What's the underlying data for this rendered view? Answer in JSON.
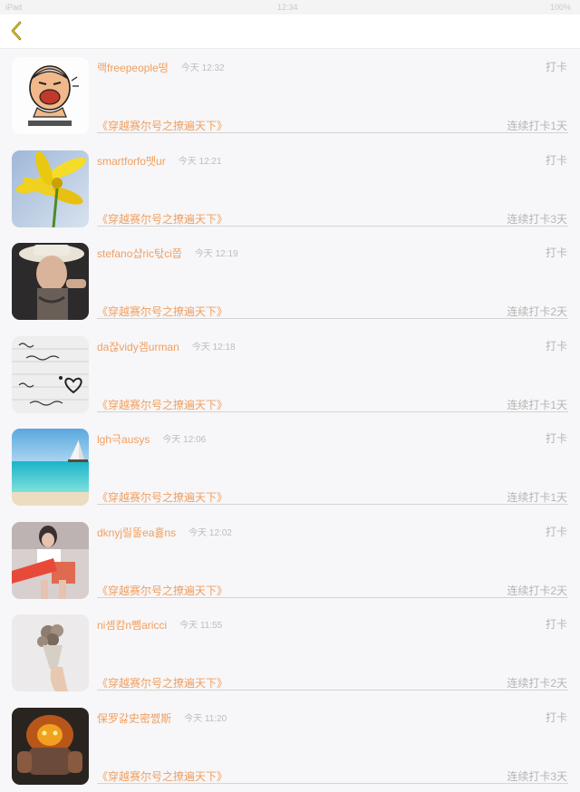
{
  "status_bar": {
    "carrier": "iPad",
    "time": "12:34",
    "battery": "100%"
  },
  "nav": {
    "back_icon": "chevron-left-icon",
    "accent": "#8a7a10"
  },
  "colors": {
    "name": "#f0a060",
    "muted": "#b5b5b5",
    "time": "#bdbdbd"
  },
  "checkins": [
    {
      "user": "랙freepeople떵",
      "time": "今天 12:32",
      "action": "打卡",
      "book": "《穿越赛尔号之撩遍天下》",
      "streak": "连续打卡1天",
      "avatar": "cartoon-face"
    },
    {
      "user": "smartforfo뗏ur",
      "time": "今天 12:21",
      "action": "打卡",
      "book": "《穿越赛尔号之撩遍天下》",
      "streak": "连续打卡3天",
      "avatar": "yellow-flower"
    },
    {
      "user": "stefano샵ric탃ci쯥",
      "time": "今天 12:19",
      "action": "打卡",
      "book": "《穿越赛尔号之撩遍天下》",
      "streak": "连续打卡2天",
      "avatar": "man-in-hat"
    },
    {
      "user": "da잖vidy겜urman",
      "time": "今天 12:18",
      "action": "打卡",
      "book": "《穿越赛尔号之撩遍天下》",
      "streak": "连续打卡1天",
      "avatar": "handwritten-note"
    },
    {
      "user": "lgh극ausys",
      "time": "今天 12:06",
      "action": "打卡",
      "book": "《穿越赛尔号之撩遍天下》",
      "streak": "连续打卡1天",
      "avatar": "beach-sailboat"
    },
    {
      "user": "dknyj릴뚤ea흃ns",
      "time": "今天 12:02",
      "action": "打卡",
      "book": "《穿越赛尔号之撩遍天下》",
      "streak": "连续打卡2天",
      "avatar": "girl-photo"
    },
    {
      "user": "ni셈캄n뻼aricci",
      "time": "今天 11:55",
      "action": "打卡",
      "book": "《穿越赛尔号之撩遍天下》",
      "streak": "连续打卡2天",
      "avatar": "hand-bouquet"
    },
    {
      "user": "保罗갏史密쩴斯",
      "time": "今天 11:20",
      "action": "打卡",
      "book": "《穿越赛尔号之撩遍天下》",
      "streak": "连续打卡3天",
      "avatar": "fire-monster"
    }
  ]
}
